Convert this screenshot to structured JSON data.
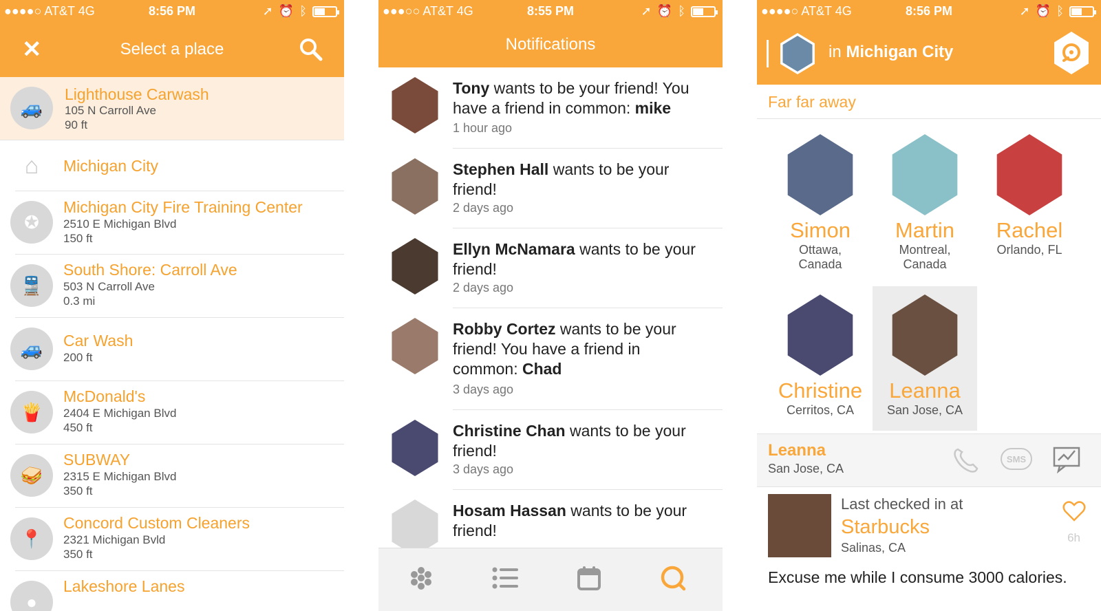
{
  "colors": {
    "accent": "#f9a73a",
    "accent_text": "#f5a22f",
    "selected_row": "#fdeedd"
  },
  "screens": [
    {
      "status": {
        "carrier": "●●●●○ AT&T   4G",
        "time": "8:56 PM",
        "battery_level": 0.5
      },
      "header": {
        "title": "Select a place",
        "close_icon": "close-icon",
        "search_icon": "search-icon"
      },
      "places": [
        {
          "name": "Lighthouse Carwash",
          "address": "105 N Carroll Ave",
          "distance": "90 ft",
          "icon": "car-wash-icon",
          "selected": true
        },
        {
          "name": "Michigan City",
          "address": "",
          "distance": "",
          "icon": "city-icon"
        },
        {
          "name": "Michigan City Fire Training Center",
          "address": "2510 E Michigan Blvd",
          "distance": "150 ft",
          "icon": "fire-station-icon"
        },
        {
          "name": "South Shore: Carroll Ave",
          "address": "503 N Carroll Ave",
          "distance": "0.3 mi",
          "icon": "train-icon"
        },
        {
          "name": "Car Wash",
          "address": "",
          "distance": "200 ft",
          "icon": "car-wash-icon"
        },
        {
          "name": "McDonald's",
          "address": "2404 E Michigan Blvd",
          "distance": "450 ft",
          "icon": "fries-icon"
        },
        {
          "name": "SUBWAY",
          "address": "2315 E Michigan Blvd",
          "distance": "350 ft",
          "icon": "sandwich-icon"
        },
        {
          "name": "Concord Custom Cleaners",
          "address": "2321 Michigan Bvld",
          "distance": "350 ft",
          "icon": "map-pin-icon"
        },
        {
          "name": "Lakeshore Lanes",
          "address": "",
          "distance": "",
          "icon": "bowling-icon"
        }
      ]
    },
    {
      "status": {
        "carrier": "●●●○○ AT&T   4G",
        "time": "8:55 PM",
        "battery_level": 0.5
      },
      "header": {
        "title": "Notifications"
      },
      "notifications": [
        {
          "name": "Tony",
          "text": " wants to be your friend! You have a friend in common: ",
          "common": "mike",
          "time": "1 hour ago",
          "avatar_color": "#7a4a3a"
        },
        {
          "name": "Stephen Hall",
          "text": " wants to be your friend!",
          "common": "",
          "time": "2 days ago",
          "avatar_color": "#8a7060"
        },
        {
          "name": "Ellyn McNamara",
          "text": " wants to be your friend!",
          "common": "",
          "time": "2 days ago",
          "avatar_color": "#4a3a30"
        },
        {
          "name": "Robby Cortez",
          "text": " wants to be your friend! You have a friend in common: ",
          "common": "Chad",
          "time": "3 days ago",
          "avatar_color": "#9a7a6a"
        },
        {
          "name": "Christine Chan",
          "text": " wants to be your friend!",
          "common": "",
          "time": "3 days ago",
          "avatar_color": "#4a4a70"
        },
        {
          "name": "Hosam Hassan",
          "text": " wants to be your friend!",
          "common": "",
          "time": "",
          "avatar_color": "#d8d8d8"
        }
      ],
      "tabs": [
        {
          "icon": "apps-grid-icon",
          "active": false
        },
        {
          "icon": "list-icon",
          "active": false
        },
        {
          "icon": "calendar-icon",
          "active": false
        },
        {
          "icon": "chat-bubble-icon",
          "active": true
        }
      ]
    },
    {
      "status": {
        "carrier": "●●●●○ AT&T   4G",
        "time": "8:56 PM",
        "battery_level": 0.5
      },
      "header": {
        "prefix": "in",
        "city": "Michigan City",
        "locate_icon": "location-target-icon"
      },
      "subtab": "Far far away",
      "friends": [
        {
          "name": "Simon",
          "location": "Ottawa, Canada",
          "avatar_color": "#5a6a8a",
          "selected": false
        },
        {
          "name": "Martin",
          "location": "Montreal, Canada",
          "avatar_color": "#8ac0c8",
          "selected": false
        },
        {
          "name": "Rachel",
          "location": "Orlando, FL",
          "avatar_color": "#c84040",
          "selected": false
        },
        {
          "name": "Christine",
          "location": "Cerritos, CA",
          "avatar_color": "#4a4a70",
          "selected": false
        },
        {
          "name": "Leanna",
          "location": "San Jose, CA",
          "avatar_color": "#6a5040",
          "selected": true
        }
      ],
      "detail": {
        "name": "Leanna",
        "location": "San Jose, CA",
        "sms_label": "SMS"
      },
      "checkin": {
        "label": "Last checked in at",
        "venue": "Starbucks",
        "venue_location": "Salinas, CA",
        "age": "6h",
        "message": "Excuse me while I consume 3000 calories."
      }
    }
  ]
}
